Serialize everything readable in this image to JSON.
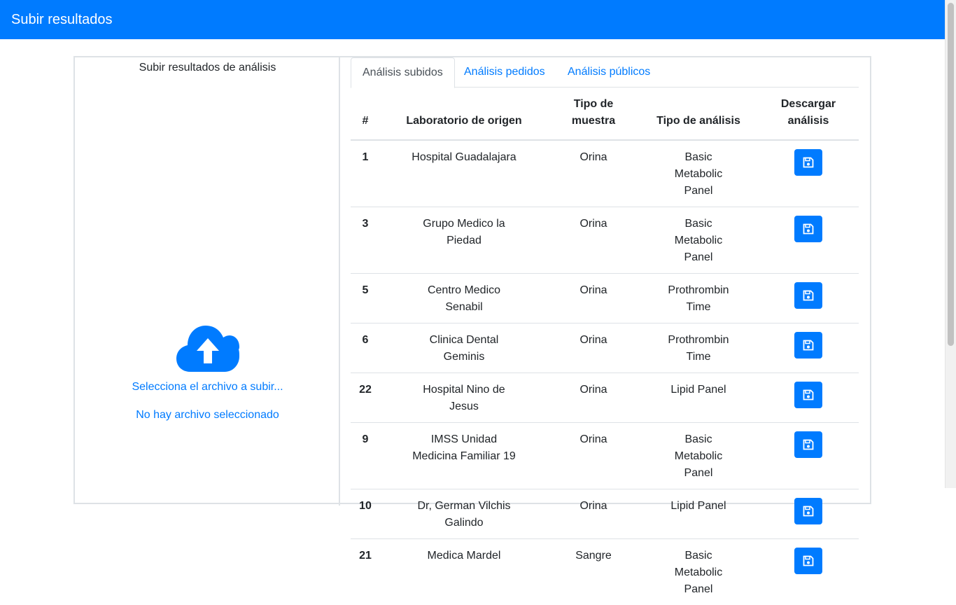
{
  "navbar": {
    "title": "Subir resultados"
  },
  "upload": {
    "title": "Subir resultados de análisis",
    "select_label": "Selecciona el archivo a subir...",
    "no_file_label": "No hay archivo seleccionado"
  },
  "tabs": [
    {
      "label": "Análisis subidos",
      "active": true
    },
    {
      "label": "Análisis pedidos",
      "active": false
    },
    {
      "label": "Análisis públicos",
      "active": false
    }
  ],
  "table": {
    "headers": {
      "num": "#",
      "lab": "Laboratorio de origen",
      "sample_line1": "Tipo de",
      "sample_line2": "muestra",
      "type": "Tipo de análisis",
      "download_line1": "Descargar",
      "download_line2": "análisis"
    },
    "rows": [
      {
        "num": "1",
        "lab": "Hospital Guadalajara",
        "sample": "Orina",
        "type": "Basic Metabolic Panel"
      },
      {
        "num": "3",
        "lab": "Grupo Medico la Piedad",
        "sample": "Orina",
        "type": "Basic Metabolic Panel"
      },
      {
        "num": "5",
        "lab": "Centro Medico Senabil",
        "sample": "Orina",
        "type": "Prothrombin Time"
      },
      {
        "num": "6",
        "lab": "Clinica Dental Geminis",
        "sample": "Orina",
        "type": "Prothrombin Time"
      },
      {
        "num": "22",
        "lab": "Hospital Nino de Jesus",
        "sample": "Orina",
        "type": "Lipid Panel"
      },
      {
        "num": "9",
        "lab": "IMSS Unidad Medicina Familiar 19",
        "sample": "Orina",
        "type": "Basic Metabolic Panel"
      },
      {
        "num": "10",
        "lab": "Dr, German Vilchis Galindo",
        "sample": "Orina",
        "type": "Lipid Panel"
      },
      {
        "num": "21",
        "lab": "Medica Mardel",
        "sample": "Sangre",
        "type": "Basic Metabolic Panel"
      }
    ]
  },
  "colors": {
    "primary": "#007bff",
    "border": "#dee2e6"
  },
  "icons": {
    "upload": "cloud-upload-icon",
    "download": "floppy-disk-icon"
  }
}
